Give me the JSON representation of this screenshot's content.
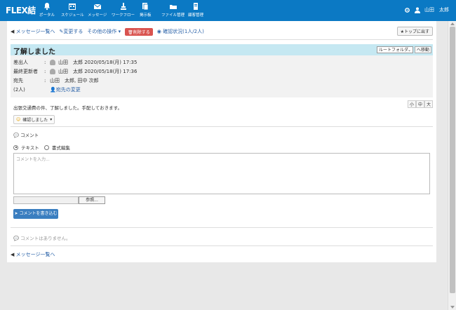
{
  "app": {
    "logo": "FLEX結"
  },
  "nav": [
    {
      "label": "ポータル",
      "icon": "bell-icon"
    },
    {
      "label": "スケジュール",
      "icon": "calendar-icon"
    },
    {
      "label": "メッセージ",
      "icon": "mail-icon"
    },
    {
      "label": "ワークフロー",
      "icon": "stamp-icon"
    },
    {
      "label": "掲示板",
      "icon": "board-icon"
    },
    {
      "label": "ファイル管理",
      "icon": "folder-icon"
    },
    {
      "label": "顧客管理",
      "icon": "customer-icon"
    }
  ],
  "user": {
    "name": "山田　太郎"
  },
  "toolbar": {
    "back": "メッセージ一覧へ",
    "edit": "変更する",
    "other": "その他の操作",
    "delete": "削除する",
    "confirm": "確認状況(1人/2人)",
    "top": "トップに出す"
  },
  "message": {
    "title": "了解しました",
    "folder": "ルートフォルダ",
    "move": "へ移動",
    "sender_label": "差出人",
    "sender": "山田　太郎 2020/05/18(月) 17:35",
    "updater_label": "最終更新者",
    "updater": "山田　太郎 2020/05/18(月) 17:36",
    "to_label": "宛先",
    "to": "山田　太郎, 田中 次郎",
    "count": "(2人)",
    "change_to": "宛先の変更",
    "body": "出張交通費の件、了解しました。手配しておきます。"
  },
  "sizes": [
    "小",
    "中",
    "大"
  ],
  "reaction": {
    "label": "確認しました"
  },
  "comment": {
    "heading": "コメント",
    "mode_text": "テキスト",
    "mode_rich": "書式編集",
    "placeholder": "コメントを入力...",
    "browse": "参照...",
    "submit": "コメントを書き込む",
    "none": "コメントはありません。"
  },
  "footer": {
    "back": "メッセージ一覧へ"
  }
}
